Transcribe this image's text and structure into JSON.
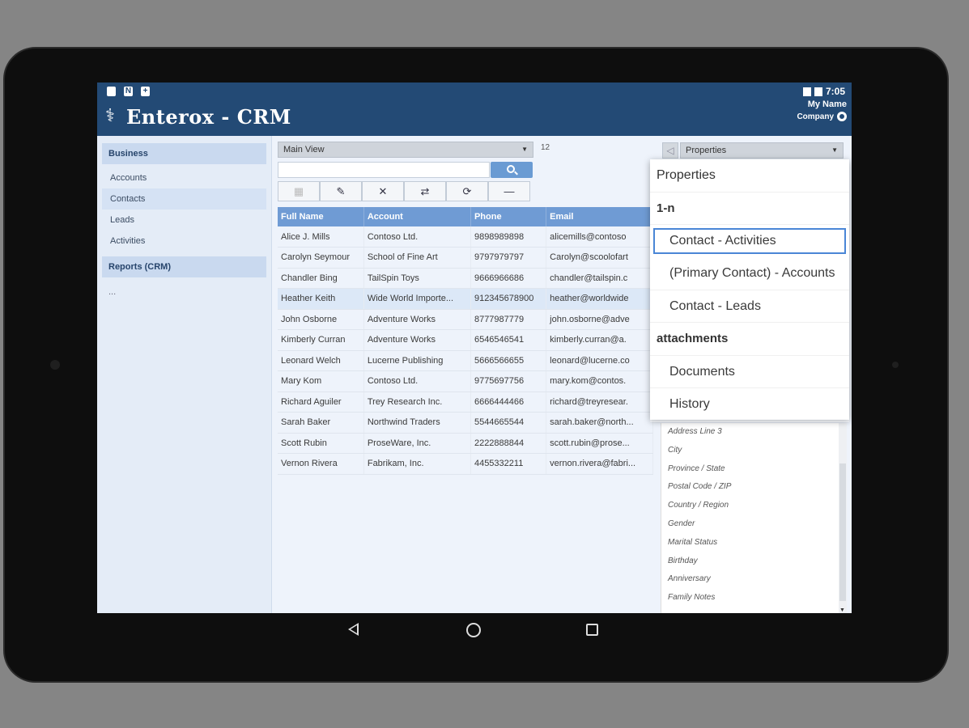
{
  "app": {
    "title": "Enterox - CRM",
    "time": "7:05",
    "user_name": "My Name",
    "company": "Company",
    "logo_glyph": "⚕"
  },
  "status_icons": [
    "N"
  ],
  "sidebar": {
    "sections": [
      {
        "label": "Business",
        "items": [
          {
            "label": "Accounts"
          },
          {
            "label": "Contacts"
          },
          {
            "label": "Leads"
          },
          {
            "label": "Activities"
          }
        ]
      },
      {
        "label": "Reports (CRM)"
      }
    ],
    "more": "..."
  },
  "main": {
    "view": "Main View",
    "count": "12",
    "search_placeholder": "",
    "toolbar": [
      "▦",
      "✎",
      "✕",
      "⇄",
      "⟳",
      "—"
    ],
    "columns": [
      "Full Name",
      "Account",
      "Phone",
      "Email"
    ],
    "rows": [
      [
        "Alice J. Mills",
        "Contoso Ltd.",
        "9898989898",
        "alicemills@contoso"
      ],
      [
        "Carolyn Seymour",
        "School of Fine Art",
        "9797979797",
        "Carolyn@scoolofart"
      ],
      [
        "Chandler Bing",
        "TailSpin Toys",
        "9666966686",
        "chandler@tailspin.c"
      ],
      [
        "Heather Keith",
        "Wide World Importe...",
        "912345678900",
        "heather@worldwide"
      ],
      [
        "John Osborne",
        "Adventure Works",
        "8777987779",
        "john.osborne@adve"
      ],
      [
        "Kimberly Curran",
        "Adventure Works",
        "6546546541",
        "kimberly.curran@a."
      ],
      [
        "Leonard Welch",
        "Lucerne Publishing",
        "5666566655",
        "leonard@lucerne.co"
      ],
      [
        "Mary Kom",
        "Contoso Ltd.",
        "9775697756",
        "mary.kom@contos."
      ],
      [
        "Richard Aguiler",
        "Trey Research Inc.",
        "6666444466",
        "richard@treyresear."
      ],
      [
        "Sarah Baker",
        "Northwind Traders",
        "5544665544",
        "sarah.baker@north..."
      ],
      [
        "Scott Rubin",
        "ProseWare, Inc.",
        "2222888844",
        "scott.rubin@prose..."
      ],
      [
        "Vernon Rivera",
        "Fabrikam, Inc.",
        "4455332211",
        "vernon.rivera@fabri..."
      ]
    ]
  },
  "properties": {
    "select": "Properties",
    "back_glyph": "◁",
    "fields": [
      "Address Line 3",
      "City",
      "Province / State",
      "Postal Code / ZIP",
      "Country / Region",
      "Gender",
      "Marital Status",
      "Birthday",
      "Anniversary",
      "Family Notes"
    ]
  },
  "menu": {
    "items": [
      {
        "label": "Properties",
        "kind": "item"
      },
      {
        "label": "1-n",
        "kind": "header"
      },
      {
        "label": "Contact - Activities",
        "kind": "child-highlight"
      },
      {
        "label": "(Primary Contact) - Accounts",
        "kind": "child"
      },
      {
        "label": "Contact - Leads",
        "kind": "child"
      },
      {
        "label": "attachments",
        "kind": "header"
      },
      {
        "label": "Documents",
        "kind": "child"
      },
      {
        "label": "History",
        "kind": "child"
      }
    ]
  },
  "colors": {
    "appbar": "#234a75",
    "grid_header": "#6f9bd4",
    "accent": "#4a86d6"
  }
}
